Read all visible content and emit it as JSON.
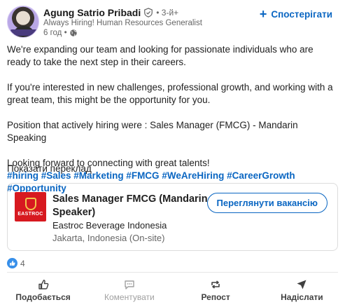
{
  "author": {
    "name": "Agung Satrio Pribadi",
    "degree": "• 3-й+",
    "headline": "Always Hiring! Human Resources Generalist",
    "time": "6 год •"
  },
  "follow_label": "Спостерігати",
  "post": {
    "p1": "We're expanding our team and looking for passionate individuals who are ready to take the next step in their careers.",
    "p2": "If you're interested in new challenges, professional growth, and working with a great team, this might be the opportunity for you.",
    "p3": "Position that actively hiring were : Sales Manager (FMCG) - Mandarin Speaking",
    "p4": "Looking forward to connecting with great talents!",
    "hashtags": "#hiring #Sales #Marketing #FMCG #WeAreHiring #CareerGrowth #Opportunity"
  },
  "translate_label": "Показати переклад",
  "job": {
    "logo_text": "EASTROC",
    "title": "Sales Manager FMCG (Mandarin Speaker)",
    "company": "Eastroc Beverage Indonesia",
    "location": "Jakarta, Indonesia (On-site)",
    "view_label": "Переглянути вакансію"
  },
  "reactions": {
    "count": "4"
  },
  "actions": {
    "like": "Подобається",
    "comment": "Коментувати",
    "repost": "Репост",
    "send": "Надіслати"
  },
  "colors": {
    "accent": "#0a66c2",
    "logo_red": "#d71920"
  }
}
